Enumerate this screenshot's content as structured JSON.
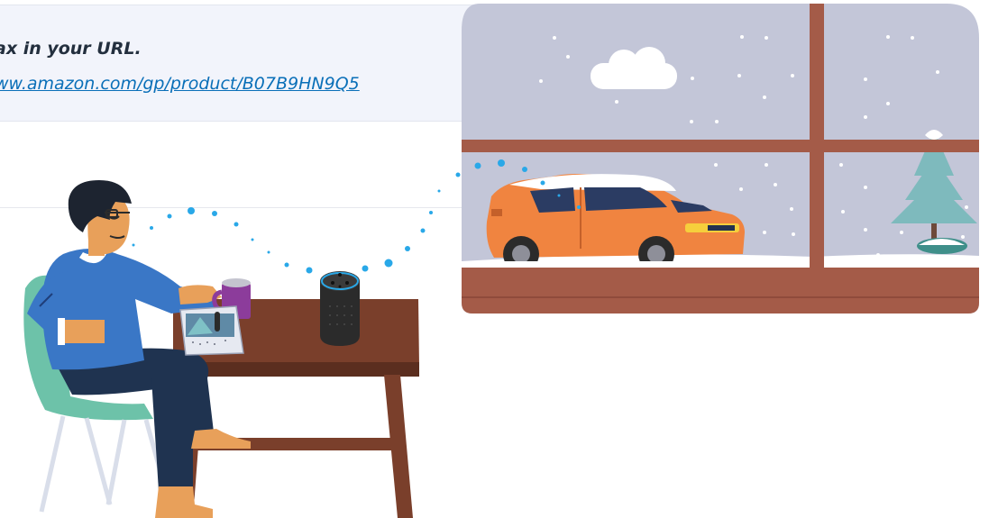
{
  "note": {
    "line1": "ax in your URL.",
    "link_text": "ww.amazon.com/gp/product/B07B9HN9Q5"
  },
  "illustration": {
    "scene": [
      {
        "name": "man-seated-at-table",
        "icon": "person-icon"
      },
      {
        "name": "smart-speaker",
        "icon": "speaker-icon"
      },
      {
        "name": "coffee-mug",
        "icon": "mug-icon"
      },
      {
        "name": "tablet-device",
        "icon": "tablet-icon"
      },
      {
        "name": "window-view",
        "icon": "window-icon"
      },
      {
        "name": "orange-car",
        "icon": "car-icon"
      },
      {
        "name": "snowy-tree",
        "icon": "tree-icon"
      },
      {
        "name": "cloud",
        "icon": "cloud-icon"
      }
    ],
    "colors": {
      "sky": "#c3c6d8",
      "window_frame": "#a45b48",
      "car": "#f08440",
      "speaker": "#2b2b2b",
      "sweater": "#3a77c6",
      "chair": "#6dc2a9",
      "pants": "#1f3350",
      "table": "#7a3f2b",
      "mug": "#8c3c9b",
      "tree": "#7ebabd",
      "voice_dots": "#29a8e8"
    }
  }
}
